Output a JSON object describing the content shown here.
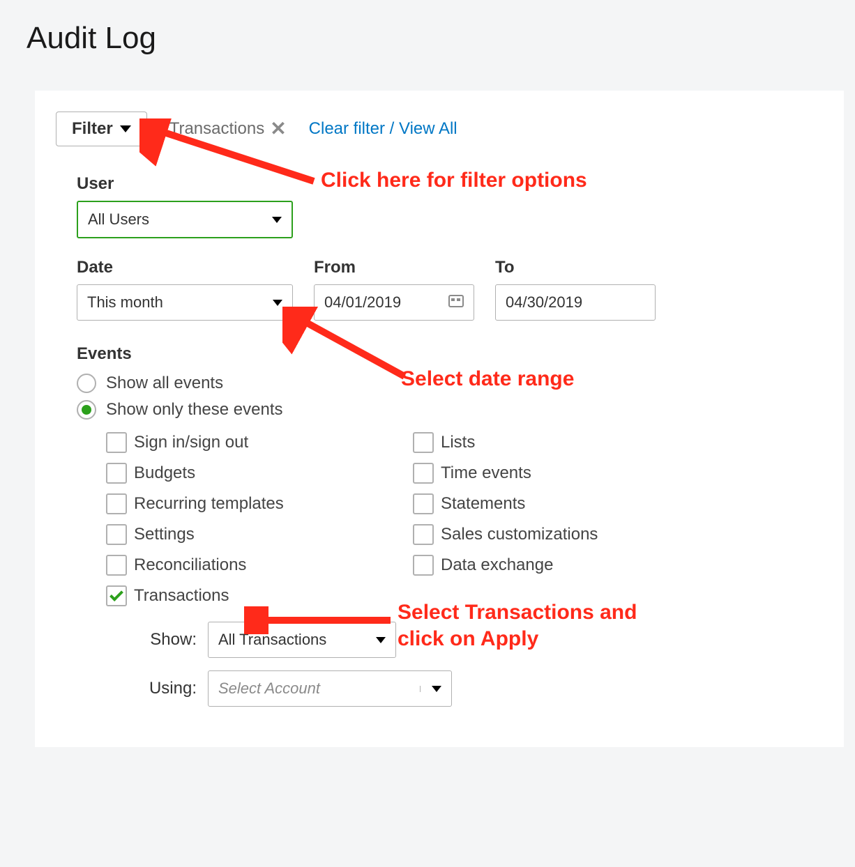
{
  "page": {
    "title": "Audit Log"
  },
  "toolbar": {
    "filter_label": "Filter",
    "chip_label": "Transactions",
    "clear_link": "Clear filter / View All"
  },
  "user": {
    "label": "User",
    "selected": "All Users"
  },
  "date": {
    "label": "Date",
    "selected": "This month",
    "from_label": "From",
    "from_value": "04/01/2019",
    "to_label": "To",
    "to_value": "04/30/2019"
  },
  "events": {
    "heading": "Events",
    "radio_all": "Show all events",
    "radio_only": "Show only these events",
    "selected_radio": "only",
    "checkboxes": [
      {
        "label": "Sign in/sign out",
        "checked": false
      },
      {
        "label": "Lists",
        "checked": false
      },
      {
        "label": "Budgets",
        "checked": false
      },
      {
        "label": "Time events",
        "checked": false
      },
      {
        "label": "Recurring templates",
        "checked": false
      },
      {
        "label": "Statements",
        "checked": false
      },
      {
        "label": "Settings",
        "checked": false
      },
      {
        "label": "Sales customizations",
        "checked": false
      },
      {
        "label": "Reconciliations",
        "checked": false
      },
      {
        "label": "Data exchange",
        "checked": false
      },
      {
        "label": "Transactions",
        "checked": true
      }
    ],
    "show_label": "Show:",
    "show_value": "All Transactions",
    "using_label": "Using:",
    "using_placeholder": "Select Account"
  },
  "annotations": {
    "a1": "Click here for filter options",
    "a2": "Select date range",
    "a3_line1": "Select Transactions and",
    "a3_line2": "click on Apply"
  },
  "colors": {
    "accent_green": "#2ca01c",
    "link_blue": "#0077c5",
    "annotation_red": "#ff2a1a"
  }
}
